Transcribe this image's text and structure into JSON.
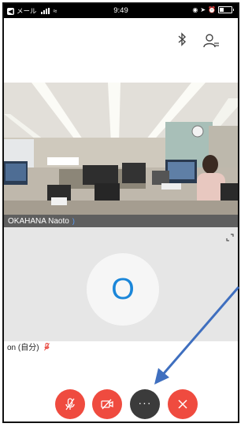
{
  "status_bar": {
    "back_app": "メール",
    "time": "9:49"
  },
  "top_bar": {
    "bluetooth_icon": "bluetooth-icon",
    "participants_icon": "participants-icon"
  },
  "remote_video": {
    "participant_name": "OKAHANA Naoto",
    "audio_indicator": ")"
  },
  "self_view": {
    "avatar_initial": "O",
    "label": "on (自分)",
    "mic_status_icon": "mic-muted-icon"
  },
  "controls": [
    {
      "name": "mute-button",
      "icon": "mic-off-icon",
      "color": "#ef4b3f"
    },
    {
      "name": "video-off-button",
      "icon": "video-off-icon",
      "color": "#ef4b3f"
    },
    {
      "name": "more-button",
      "icon": "more-dots-icon",
      "label": "···",
      "color": "#3b3b3b"
    },
    {
      "name": "end-call-button",
      "icon": "close-icon",
      "color": "#ef4b3f"
    }
  ],
  "annotation": {
    "arrow_color": "#3f6fbf",
    "target": "more-button"
  }
}
